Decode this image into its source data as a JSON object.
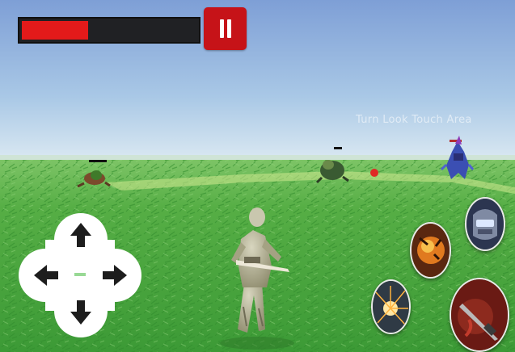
{
  "hud": {
    "health_fraction": 0.38,
    "health_color": "#e31a1a",
    "pause_color": "#c61318",
    "pause_icon": "pause-icon"
  },
  "watermark": "Turn Look Touch Area",
  "dpad": {
    "up_icon": "arrow-up-icon",
    "down_icon": "arrow-down-icon",
    "left_icon": "arrow-left-icon",
    "right_icon": "arrow-right-icon"
  },
  "skills": [
    {
      "id": "visor-helmet",
      "icon": "robot-visor-icon"
    },
    {
      "id": "fire-orb",
      "icon": "flame-orb-icon"
    },
    {
      "id": "sparks",
      "icon": "spark-icon"
    },
    {
      "id": "weapon-blade",
      "icon": "sword-icon"
    }
  ],
  "colors": {
    "sky_top": "#7e9fd6",
    "horizon": "#d8e7f1",
    "grass": "#49a73e"
  }
}
